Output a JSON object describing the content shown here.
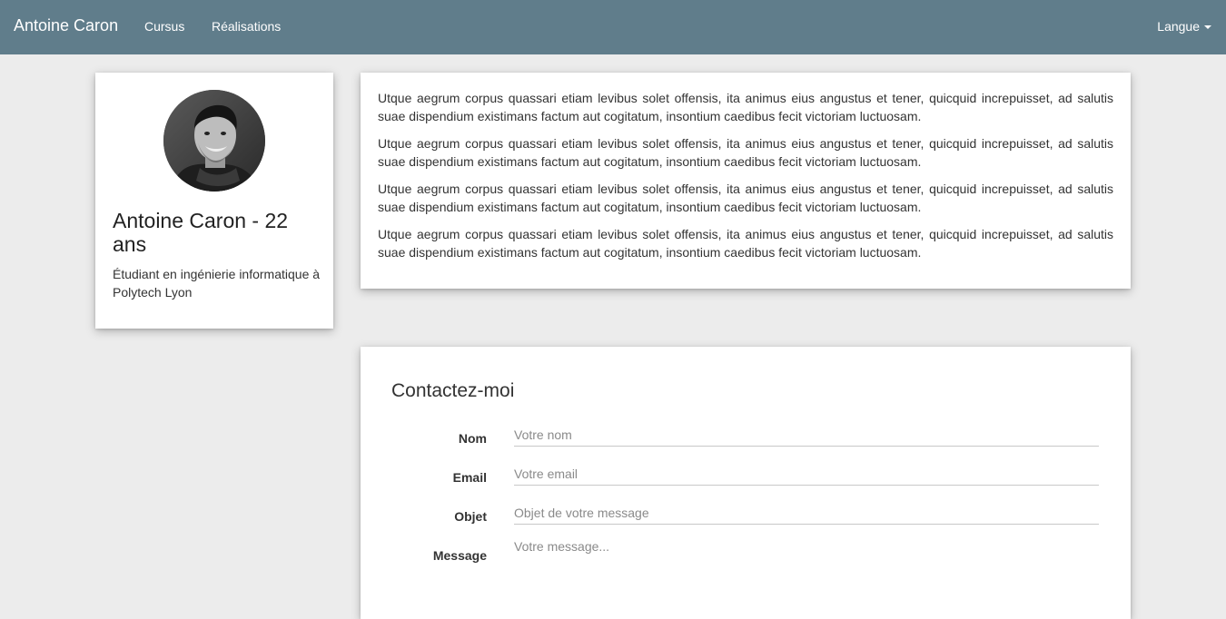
{
  "navbar": {
    "brand": "Antoine Caron",
    "links": [
      "Cursus",
      "Réalisations"
    ],
    "language_label": "Langue"
  },
  "profile": {
    "name": "Antoine Caron - 22 ans",
    "description": "Étudiant en ingénierie informatique à Polytech Lyon"
  },
  "about": {
    "paragraphs": [
      "Utque aegrum corpus quassari etiam levibus solet offensis, ita animus eius angustus et tener, quicquid increpuisset, ad salutis suae dispendium existimans factum aut cogitatum, insontium caedibus fecit victoriam luctuosam.",
      "Utque aegrum corpus quassari etiam levibus solet offensis, ita animus eius angustus et tener, quicquid increpuisset, ad salutis suae dispendium existimans factum aut cogitatum, insontium caedibus fecit victoriam luctuosam.",
      "Utque aegrum corpus quassari etiam levibus solet offensis, ita animus eius angustus et tener, quicquid increpuisset, ad salutis suae dispendium existimans factum aut cogitatum, insontium caedibus fecit victoriam luctuosam.",
      "Utque aegrum corpus quassari etiam levibus solet offensis, ita animus eius angustus et tener, quicquid increpuisset, ad salutis suae dispendium existimans factum aut cogitatum, insontium caedibus fecit victoriam luctuosam."
    ]
  },
  "contact": {
    "title": "Contactez-moi",
    "fields": {
      "name": {
        "label": "Nom",
        "placeholder": "Votre nom"
      },
      "email": {
        "label": "Email",
        "placeholder": "Votre email"
      },
      "subject": {
        "label": "Objet",
        "placeholder": "Objet de votre message"
      },
      "message": {
        "label": "Message",
        "placeholder": "Votre message..."
      }
    }
  },
  "colors": {
    "navbar": "#607d8b",
    "page_background": "#ececec",
    "card": "#ffffff"
  }
}
